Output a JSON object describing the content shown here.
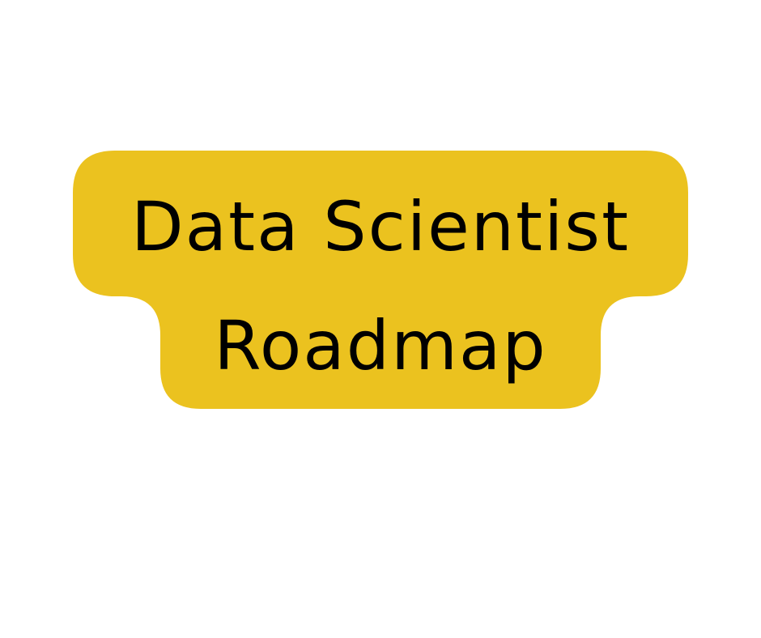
{
  "title": {
    "line_1": "Data Scientist",
    "line_2": "Roadmap"
  },
  "colors": {
    "background": "#ffffff",
    "badge_fill": "#EBC21F",
    "text": "#000000"
  }
}
